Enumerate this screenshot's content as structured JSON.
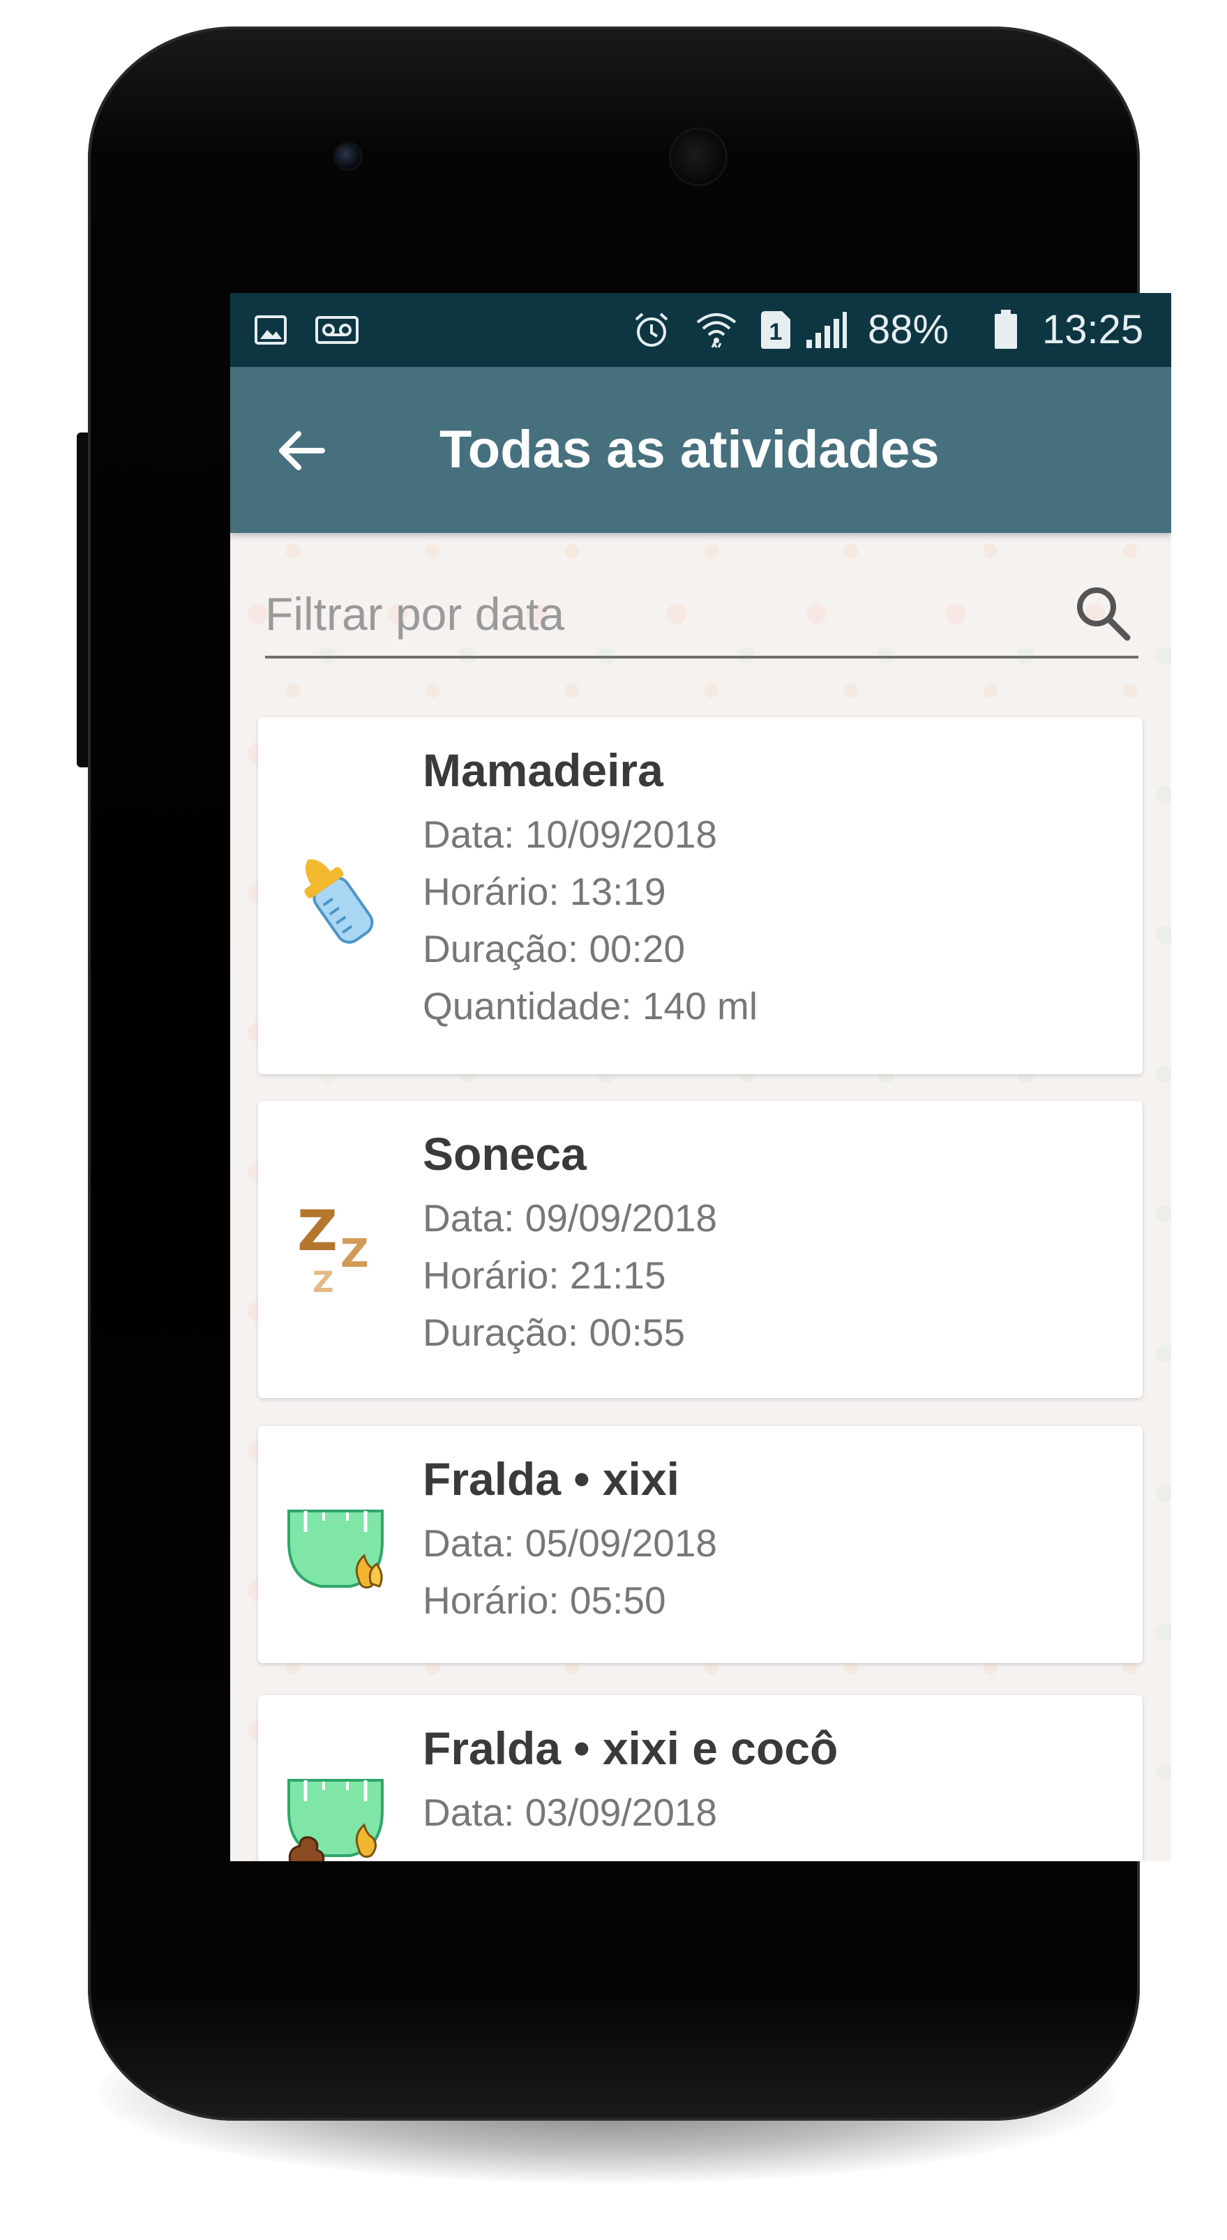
{
  "status_bar": {
    "battery": "88%",
    "time": "13:25",
    "sim_label": "1",
    "icons": [
      "image-icon",
      "voicemail-icon",
      "alarm-icon",
      "wifi-icon",
      "sim-icon",
      "signal-icon",
      "battery-icon"
    ]
  },
  "app_bar": {
    "title": "Todas as atividades",
    "back_icon": "arrow-back-icon"
  },
  "search": {
    "placeholder": "Filtrar por data",
    "value": "",
    "icon": "search-icon"
  },
  "activities": [
    {
      "title": "Mamadeira",
      "icon": "baby-bottle-icon",
      "lines": [
        "Data: 10/09/2018",
        "Horário: 13:19",
        "Duração: 00:20",
        "Quantidade: 140 ml"
      ]
    },
    {
      "title": "Soneca",
      "icon": "sleep-zzz-icon",
      "lines": [
        "Data: 09/09/2018",
        "Horário: 21:15",
        "Duração: 00:55"
      ]
    },
    {
      "title": "Fralda • xixi",
      "icon": "diaper-pee-icon",
      "lines": [
        "Data: 05/09/2018",
        "Horário: 05:50"
      ]
    },
    {
      "title": "Fralda • xixi e cocô",
      "icon": "diaper-pee-poop-icon",
      "lines": [
        "Data: 03/09/2018"
      ]
    }
  ],
  "colors": {
    "status_bar": "#0d3642",
    "app_bar": "#46707e",
    "background": "#f5f2f0",
    "card": "#ffffff",
    "title_text": "#3a3a3a",
    "detail_text": "#777777"
  }
}
